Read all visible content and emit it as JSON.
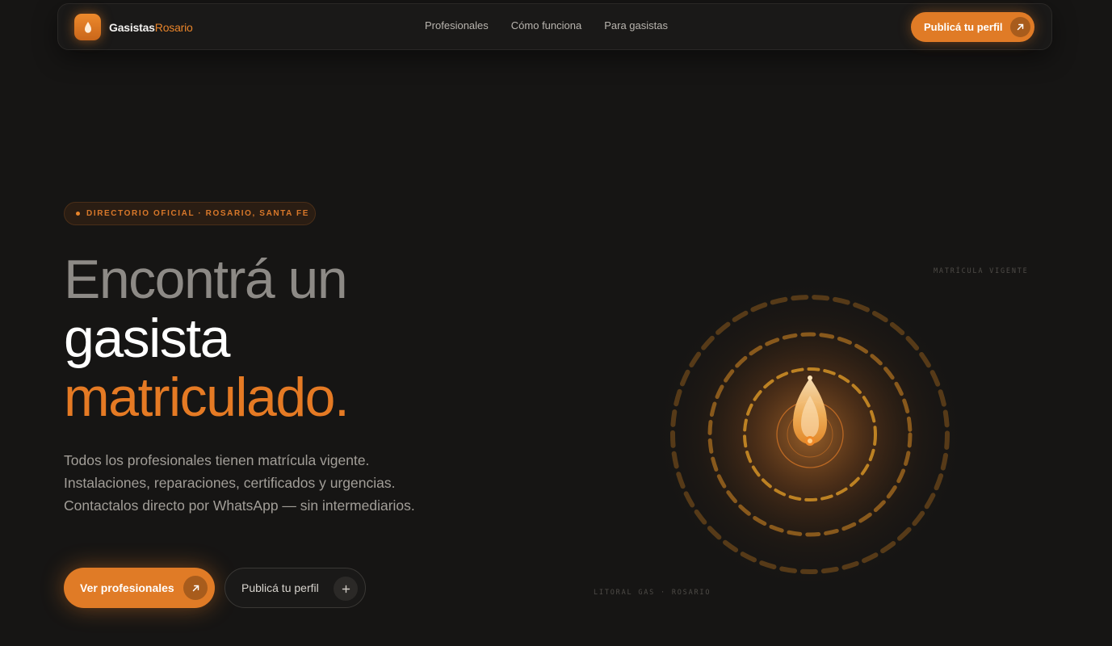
{
  "brand": {
    "name_a": "Gasistas",
    "name_b": "Rosario"
  },
  "nav": {
    "links": [
      "Profesionales",
      "Cómo funciona",
      "Para gasistas"
    ],
    "cta_label": "Publicá tu perfil"
  },
  "hero": {
    "badge": "DIRECTORIO OFICIAL · ROSARIO, SANTA FE",
    "headline": {
      "line1": "Encontrá un",
      "line2": "gasista",
      "line3": "matriculado."
    },
    "description": "Todos los profesionales tienen matrícula vigente. Instalaciones, reparaciones, certificados y urgencias. Contactalos directo por WhatsApp — sin intermediarios.",
    "primary_button": "Ver profesionales",
    "secondary_button": "Publicá tu perfil"
  },
  "visual": {
    "label_top": "MATRÍCULA VIGENTE",
    "label_bottom": "LITORAL GAS · ROSARIO"
  },
  "colors": {
    "accent": "#e07b26",
    "background": "#161514"
  }
}
